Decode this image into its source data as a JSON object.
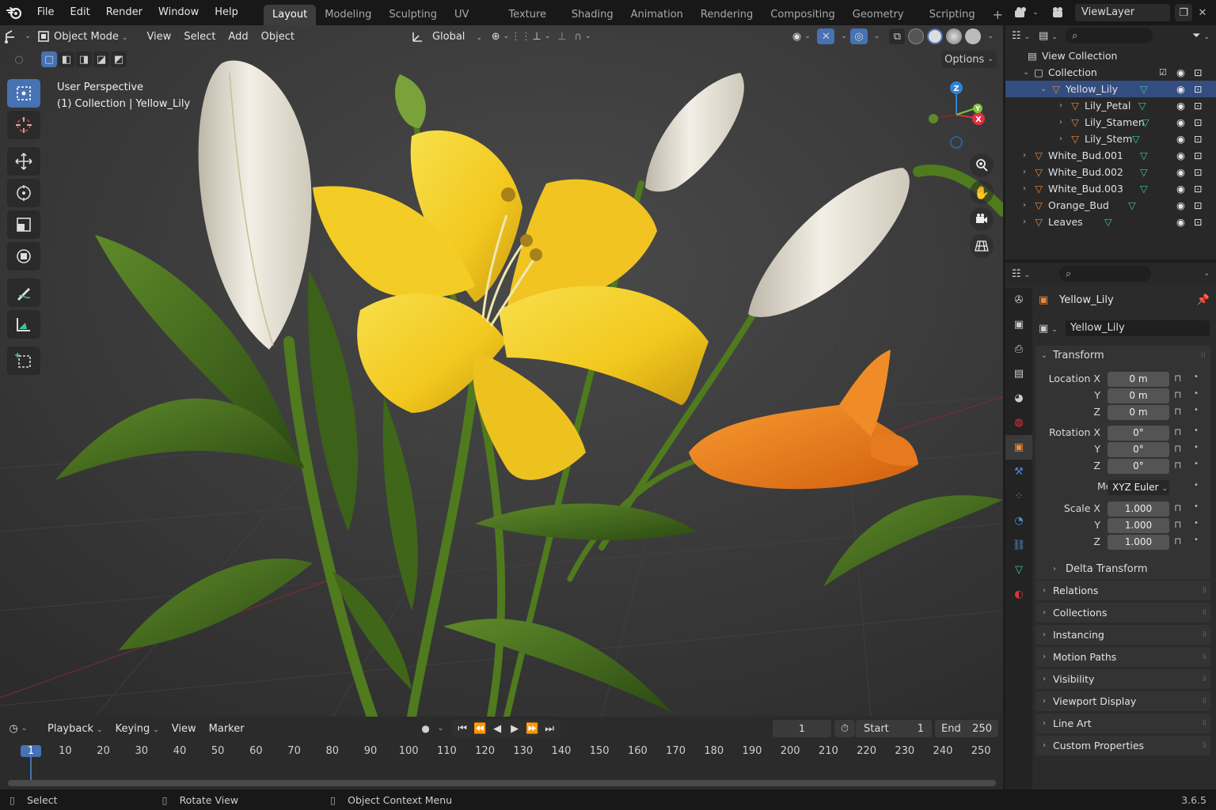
{
  "app": {
    "version": "3.6.5"
  },
  "menu": [
    "File",
    "Edit",
    "Render",
    "Window",
    "Help"
  ],
  "workspaces": [
    "Layout",
    "Modeling",
    "Sculpting",
    "UV Editing",
    "Texture Paint",
    "Shading",
    "Animation",
    "Rendering",
    "Compositing",
    "Geometry Nodes",
    "Scripting"
  ],
  "active_workspace": "Layout",
  "view_layer": "ViewLayer",
  "viewport": {
    "mode": "Object Mode",
    "menus": [
      "View",
      "Select",
      "Add",
      "Object"
    ],
    "orientation": "Global",
    "options_label": "Options",
    "overlay_line1": "User Perspective",
    "overlay_line2": "(1) Collection | Yellow_Lily",
    "gizmo_labels": {
      "z": "Z",
      "y": "Y",
      "x": "X"
    }
  },
  "outliner": {
    "rows": [
      {
        "label": "View Collection",
        "type": "scene"
      },
      {
        "label": "Collection",
        "type": "collection"
      },
      {
        "label": "Yellow_Lily",
        "type": "object",
        "selected": true
      },
      {
        "label": "Lily_Petal",
        "type": "object"
      },
      {
        "label": "Lily_Stamen",
        "type": "object"
      },
      {
        "label": "Lily_Stem",
        "type": "object"
      },
      {
        "label": "White_Bud.001",
        "type": "object"
      },
      {
        "label": "White_Bud.002",
        "type": "object"
      },
      {
        "label": "White_Bud.003",
        "type": "object"
      },
      {
        "label": "Orange_Bud",
        "type": "object"
      },
      {
        "label": "Leaves",
        "type": "object"
      }
    ]
  },
  "properties": {
    "object_name": "Yellow_Lily",
    "data_name": "Yellow_Lily",
    "transform_title": "Transform",
    "location_label": "Location X",
    "rotation_label": "Rotation X",
    "scale_label": "Scale X",
    "axis_y": "Y",
    "axis_z": "Z",
    "location": [
      "0 m",
      "0 m",
      "0 m"
    ],
    "rotation": [
      "0°",
      "0°",
      "0°"
    ],
    "mode_label": "Mode",
    "mode_value": "XYZ Euler",
    "scale": [
      "1.000",
      "1.000",
      "1.000"
    ],
    "delta": "Delta Transform",
    "panels": [
      "Relations",
      "Collections",
      "Instancing",
      "Motion Paths",
      "Visibility",
      "Viewport Display",
      "Line Art",
      "Custom Properties"
    ]
  },
  "timeline": {
    "menus": [
      "Playback",
      "Keying",
      "View",
      "Marker"
    ],
    "current_frame": "1",
    "start_label": "Start",
    "start": "1",
    "end_label": "End",
    "end": "250",
    "ruler": [
      "1",
      "10",
      "20",
      "30",
      "40",
      "50",
      "60",
      "70",
      "80",
      "90",
      "100",
      "110",
      "120",
      "130",
      "140",
      "150",
      "160",
      "170",
      "180",
      "190",
      "200",
      "210",
      "220",
      "230",
      "240",
      "250"
    ]
  },
  "status": {
    "select": "Select",
    "rotate": "Rotate View",
    "context": "Object Context Menu"
  },
  "colors": {
    "accent": "#4772b3",
    "object": "#e98a3a",
    "mesh": "#3fc4a3",
    "x_axis": "#e0303f",
    "y_axis": "#79c33b",
    "z_axis": "#2f82d9"
  }
}
